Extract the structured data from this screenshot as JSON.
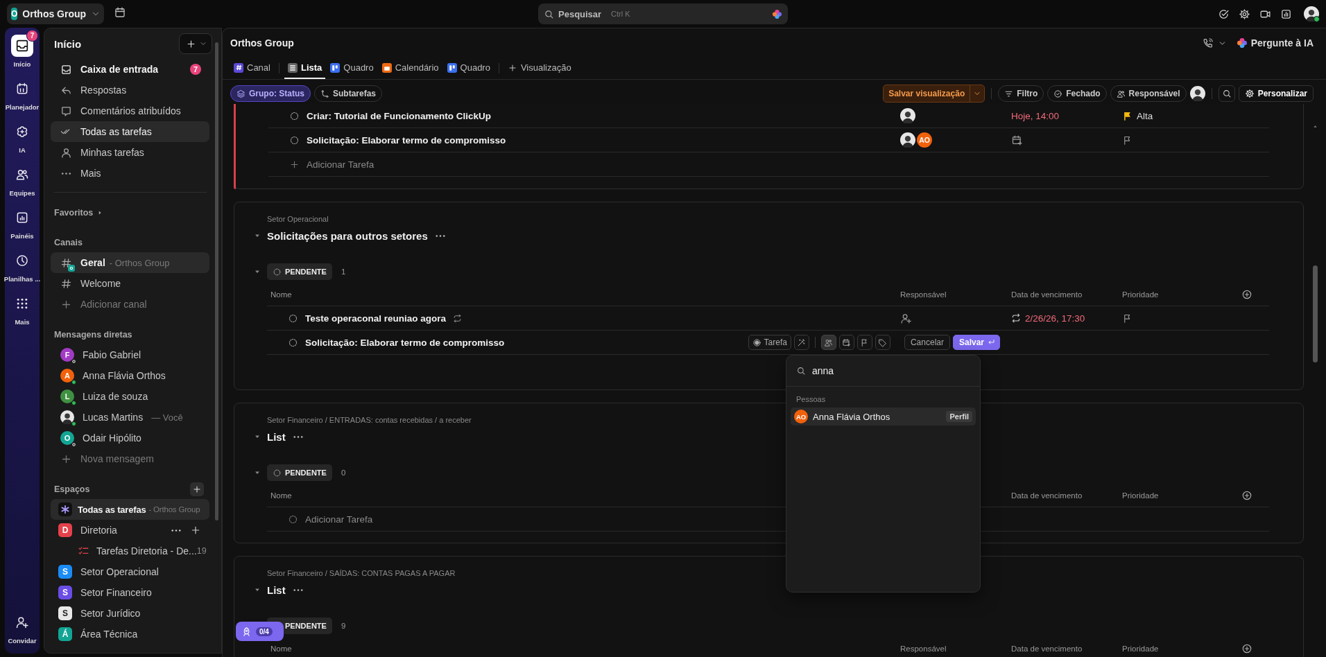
{
  "top_bar": {
    "workspace": {
      "initial": "O",
      "name": "Orthos Group"
    },
    "search": {
      "placeholder": "Pesquisar",
      "shortcut": "Ctrl K"
    }
  },
  "rail": {
    "items": [
      {
        "label": "Início",
        "selected": true,
        "badge": "7"
      },
      {
        "label": "Planejador",
        "selected": false
      },
      {
        "label": "IA",
        "selected": false
      },
      {
        "label": "Equipes",
        "selected": false
      },
      {
        "label": "Painéis",
        "selected": false
      },
      {
        "label": "Planilhas ...",
        "selected": false
      },
      {
        "label": "Mais",
        "selected": false
      }
    ],
    "invite": "Convidar"
  },
  "sidebar": {
    "title": "Início",
    "nav": [
      {
        "label": "Caixa de entrada",
        "selected": false,
        "unread": true,
        "badge": "7"
      },
      {
        "label": "Respostas",
        "selected": false,
        "unread": false
      },
      {
        "label": "Comentários atribuídos",
        "selected": false,
        "unread": false
      },
      {
        "label": "Todas as tarefas",
        "selected": true,
        "unread": false
      },
      {
        "label": "Minhas tarefas",
        "selected": false,
        "unread": false
      },
      {
        "label": "Mais",
        "selected": false,
        "unread": false
      }
    ],
    "favorites": "Favoritos",
    "channels": {
      "title": "Canais",
      "items": [
        {
          "name": "Geral",
          "suffix": "- Orthos Group",
          "badge": "o",
          "selected": true
        },
        {
          "name": "Welcome",
          "selected": false
        }
      ],
      "add": "Adicionar canal"
    },
    "direct_messages": {
      "title": "Mensagens diretas",
      "items": [
        {
          "kind": "initial",
          "initial": "F",
          "color": "#a23bc4",
          "name": "Fabio Gabriel",
          "online": false
        },
        {
          "kind": "initial",
          "initial": "A",
          "color": "#f2610b",
          "name": "Anna Flávia Orthos",
          "online": true
        },
        {
          "kind": "initial",
          "initial": "L",
          "color": "#3f9142",
          "name": "Luiza de souza",
          "online": true
        },
        {
          "kind": "photo",
          "name": "Lucas Martins",
          "suffix": "— Você",
          "online": true
        },
        {
          "kind": "initial",
          "initial": "O",
          "color": "#13a594",
          "name": "Odair Hipólito",
          "online": false
        }
      ],
      "add": "Nova mensagem"
    },
    "spaces": {
      "title": "Espaços",
      "items": [
        {
          "kind": "all",
          "name": "Todas as tarefas",
          "suffix": "- Orthos Group",
          "selected": true
        },
        {
          "kind": "space",
          "initial": "D",
          "color": "#e5414b",
          "name": "Diretoria",
          "selected": false,
          "children": [
            {
              "name": "Tarefas Diretoria - De...",
              "count": "19"
            }
          ]
        },
        {
          "kind": "space",
          "initial": "S",
          "color": "#1b8cf5",
          "name": "Setor Operacional",
          "selected": false
        },
        {
          "kind": "space",
          "initial": "S",
          "color": "#6b4de6",
          "name": "Setor Financeiro",
          "selected": false
        },
        {
          "kind": "space",
          "initial": "S",
          "color": "#e8e8e8",
          "name": "Setor Jurídico",
          "selected": false
        },
        {
          "kind": "space",
          "initial": "Á",
          "color": "#13a594",
          "name": "Área Técnica",
          "selected": false
        }
      ]
    }
  },
  "main": {
    "title": "Orthos Group",
    "ask_ai": "Pergunte à IA",
    "tabs": [
      {
        "label": "Canal",
        "selected": false
      },
      {
        "label": "Lista",
        "selected": true
      },
      {
        "label": "Quadro",
        "selected": false
      },
      {
        "label": "Calendário",
        "selected": false
      },
      {
        "label": "Quadro",
        "selected": false
      }
    ],
    "add_view": "Visualização",
    "toolbar": {
      "group_by": "Grupo: Status",
      "subtasks": "Subtarefas",
      "save_view": "Salvar visualização",
      "filter": "Filtro",
      "closed": "Fechado",
      "assignee": "Responsável",
      "customize": "Personalizar"
    },
    "sections": [
      {
        "color": "#d6404b",
        "rows": [
          {
            "name": "Criar: Tutorial de Funcionamento ClickUp",
            "assignees": [
              {
                "kind": "photo"
              }
            ],
            "due": "Hoje, 14:00",
            "overdue": true,
            "priority": {
              "label": "Alta",
              "color": "#f5b90f"
            }
          },
          {
            "name": "Solicitação: Elaborar termo de compromisso",
            "assignees": [
              {
                "kind": "photo"
              },
              {
                "kind": "initials",
                "initials": "AO",
                "color": "#f2610b"
              }
            ]
          }
        ],
        "add_task": "Adicionar Tarefa"
      },
      {
        "breadcrumb": "Setor Operacional",
        "title": "Solicitações para outros setores",
        "status": "PENDENTE",
        "count": "1",
        "columns": [
          {
            "kind": "name",
            "label": "Nome"
          },
          {
            "kind": "assignee",
            "label": "Responsável"
          },
          {
            "kind": "due",
            "label": "Data de vencimento"
          },
          {
            "kind": "priority",
            "label": "Prioridade"
          }
        ],
        "rows": [
          {
            "name": "Teste operaconal reuniao agora",
            "recurring": true,
            "due": "2/26/26, 17:30",
            "overdue": true
          }
        ],
        "draft": {
          "name": "Solicitação: Elaborar termo de compromisso",
          "type": "Tarefa",
          "cancel": "Cancelar",
          "save": "Salvar"
        }
      },
      {
        "breadcrumb": "Setor Financeiro / ENTRADAS: contas recebidas / a receber",
        "title": "List",
        "status": "PENDENTE",
        "count": "0",
        "columns": [
          {
            "kind": "name",
            "label": "Nome"
          },
          {
            "kind": "due",
            "label": "Data de vencimento"
          },
          {
            "kind": "priority",
            "label": "Prioridade"
          }
        ],
        "add_task": "Adicionar Tarefa"
      },
      {
        "breadcrumb": "Setor Financeiro / SAÍDAS: CONTAS PAGAS A PAGAR",
        "title": "List",
        "status": "PENDENTE",
        "count": "9",
        "columns": [
          {
            "kind": "name",
            "label": "Nome"
          },
          {
            "kind": "assignee",
            "label": "Responsável"
          },
          {
            "kind": "due",
            "label": "Data de vencimento"
          },
          {
            "kind": "priority",
            "label": "Prioridade"
          }
        ]
      }
    ],
    "assignee_picker": {
      "query": "anna",
      "group": "Pessoas",
      "results": [
        {
          "initials": "AO",
          "color": "#f2610b",
          "name": "Anna Flávia Orthos",
          "action": "Perfil"
        }
      ]
    },
    "onboarding": {
      "progress": "0/4"
    }
  }
}
